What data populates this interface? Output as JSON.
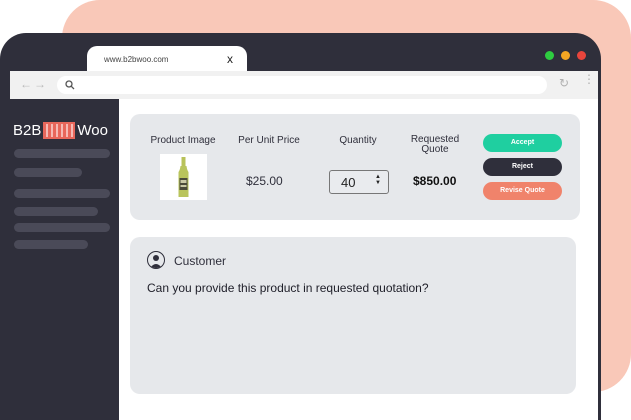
{
  "browser": {
    "tab_title": "www.b2bwoo.com",
    "tab_close": "x",
    "nav_arrows": "←→",
    "reload_glyph": "↻",
    "menu_glyph": "⋮",
    "window_dots": [
      "#2ecc40",
      "#f5a623",
      "#e8453c"
    ]
  },
  "sidebar": {
    "logo_prefix": "B2B",
    "logo_suffix": "Woo",
    "logo_mark_colors": [
      "#e8675b",
      "#ffffff"
    ]
  },
  "quote_card": {
    "headers": {
      "product_image": "Product Image",
      "unit_price": "Per Unit Price",
      "quantity": "Quantity",
      "requested_quote": "Requested Quote"
    },
    "unit_price": "$25.00",
    "quantity": "40",
    "requested_quote": "$850.00",
    "buttons": {
      "accept": "Accept",
      "reject": "Reject",
      "revise": "Revise Quote"
    },
    "colors": {
      "accept": "#1fcfa0",
      "reject": "#2f2f3b",
      "revise": "#f0836b"
    }
  },
  "message_card": {
    "author": "Customer",
    "message": "Can you provide this product in requested quotation?"
  }
}
